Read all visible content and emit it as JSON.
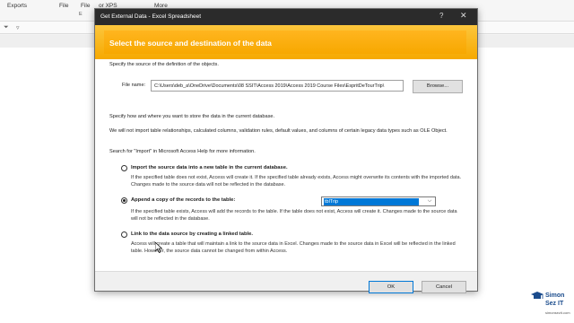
{
  "background": {
    "ribbon_items": [
      "Exports",
      "File",
      "File",
      "or XPS",
      "More"
    ],
    "ribbon_sub": "E"
  },
  "dialog": {
    "title": "Get External Data - Excel Spreadsheet",
    "help_glyph": "?",
    "close_glyph": "✕",
    "heading": "Select the source and destination of the data",
    "source_prompt": "Specify the source of the definition of the objects.",
    "file_name_label": "File name:",
    "file_name_value": "C:\\Users\\deb_a\\OneDrive\\Documents\\08 SSIT\\Access 2019\\Access 2019 Course Files\\EspritDeTourTrip\\",
    "browse_label": "Browse...",
    "store_prompt": "Specify how and where you want to store the data in the current database.",
    "import_note": "We will not import table relationships, calculated columns, validation rules, default values, and columns of certain legacy data types such as OLE Object.",
    "help_note": "Search for \"Import\" in Microsoft Access Help for more information.",
    "options": [
      {
        "label": "Import the source data into a new table in the current database.",
        "description": "If the specified table does not exist, Access will create it. If the specified table already exists, Access might overwrite its contents with the imported data. Changes made to the source data will not be reflected in the database.",
        "selected": false
      },
      {
        "label": "Append a copy of the records to the table:",
        "description": "If the specified table exists, Access will add the records to the table. If the table does not exist, Access will create it. Changes made to the source data will not be reflected in the database.",
        "selected": true
      },
      {
        "label": "Link to the data source by creating a linked table.",
        "description": "Access will create a table that will maintain a link to the source data in Excel. Changes made to the source data in Excel will be reflected in the linked table. However, the source data cannot be changed from within Access.",
        "selected": false
      }
    ],
    "append_table_value": "tblTrip",
    "ok_label": "OK",
    "cancel_label": "Cancel"
  },
  "watermark": {
    "line1": "Simon",
    "line2": "Sez IT",
    "url": "simonsezit.com"
  },
  "colors": {
    "banner": "#f6a900",
    "titlebar": "#2b2b2b",
    "selection": "#0078d7"
  }
}
